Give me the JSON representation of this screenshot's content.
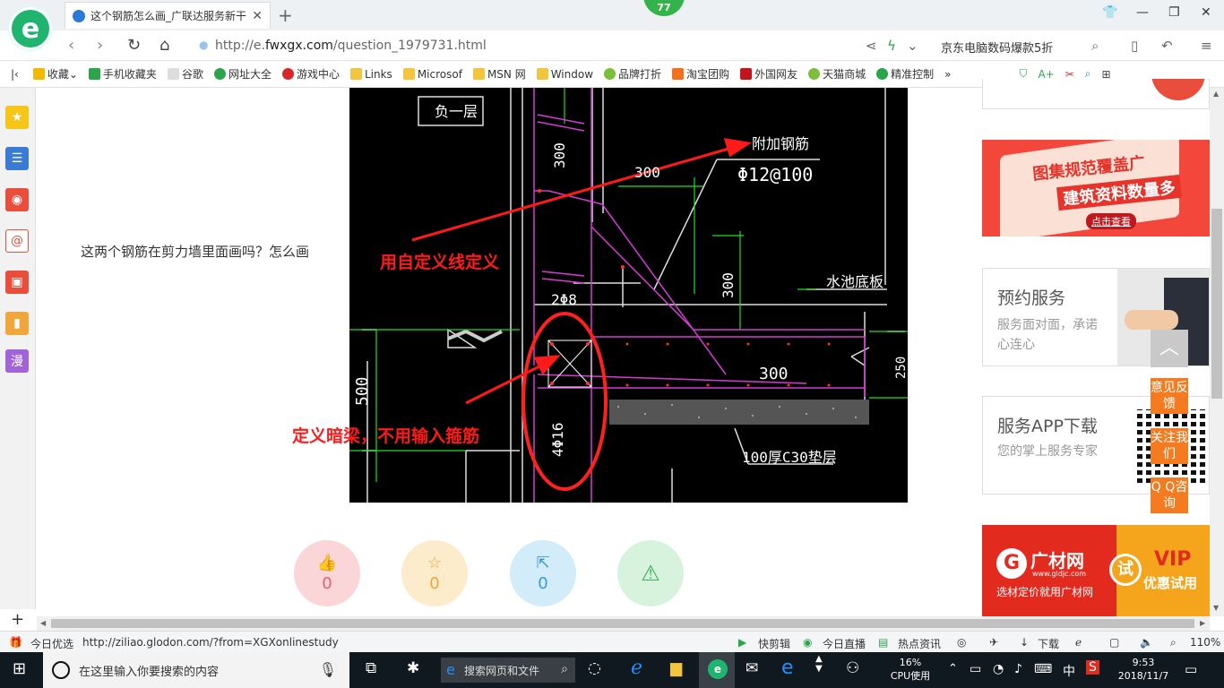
{
  "browser": {
    "tab_title": "这个钢筋怎么画_广联达服务新干",
    "badge": "77",
    "url_prefix": "http://e.",
    "url_domain": "fwxgx.com",
    "url_path": "/question_1979731.html",
    "right_search": "京东电脑数码爆款5折"
  },
  "bookmarks": [
    {
      "label": "收藏",
      "color": "#f5b800"
    },
    {
      "label": "手机收藏夹",
      "color": "#2aa54a"
    },
    {
      "label": "谷歌",
      "color": "#888888"
    },
    {
      "label": "网址大全",
      "color": "#2aa54a"
    },
    {
      "label": "游戏中心",
      "color": "#d9262b"
    },
    {
      "label": "Links",
      "color": "#f3c43e"
    },
    {
      "label": "Microsof",
      "color": "#f3c43e"
    },
    {
      "label": "MSN 网",
      "color": "#f3c43e"
    },
    {
      "label": "Window",
      "color": "#f3c43e"
    },
    {
      "label": "品牌打折",
      "color": "#7cbf3a"
    },
    {
      "label": "淘宝团购",
      "color": "#f46f1e"
    },
    {
      "label": "外国网友",
      "color": "#c3161c"
    },
    {
      "label": "天猫商城",
      "color": "#7cbf3a"
    },
    {
      "label": "精准控制",
      "color": "#2aa54a"
    }
  ],
  "question_text": "这两个钢筋在剪力墙里面画吗？怎么画",
  "cad": {
    "label_floor": "负一层",
    "label_rebar": "附加钢筋",
    "label_rebar_spec": "Φ12@100",
    "dim_300_a": "300",
    "dim_300_b": "300",
    "dim_300_c": "300",
    "dim_300_d": "300",
    "label_2phi8": "2Φ8",
    "label_pool": "水池底板",
    "dim_500": "500",
    "label_4phi16": "4Φ16",
    "label_cushion": "100厚C30垫层",
    "dim_250": "250",
    "annot_custom_line": "用自定义线定义",
    "annot_hidden_beam": "定义暗梁，不用输入箍筋"
  },
  "actions": [
    {
      "icon": "thumb-up-icon",
      "glyph": "👍",
      "count": "0",
      "bg": "#fbd6d9",
      "color": "#e4606d"
    },
    {
      "icon": "star-icon",
      "glyph": "☆",
      "count": "0",
      "bg": "#fdeccb",
      "color": "#f0a63a"
    },
    {
      "icon": "share-icon",
      "glyph": "⇱",
      "count": "0",
      "bg": "#d2ecfa",
      "color": "#3a9ad6"
    },
    {
      "icon": "report-icon",
      "glyph": "⚠",
      "count": "",
      "bg": "#d7f3de",
      "color": "#3bb15a"
    }
  ],
  "right": {
    "promo1_line1": "图集规范覆盖广",
    "promo1_line2": "建筑资料数量多",
    "promo1_btn": "点击查看",
    "card1_title": "预约服务",
    "card1_sub": "服务面对面，承诺心连心",
    "card2_title": "服务APP下载",
    "card2_sub": "您的掌上服务专家",
    "promo2_brand": "广材网",
    "promo2_url": "www.gldjc.com",
    "promo2_tag": "选材定价就用广材网",
    "promo2_try": "试",
    "promo2_vip": "VIP",
    "promo2_vip_sub": "优惠试用",
    "float_feedback": "意见反馈",
    "float_follow": "关注我们",
    "float_qq": "Q Q咨询"
  },
  "status": {
    "today": "今日优选",
    "url": "http://ziliao.glodon.com/?from=XGXonlinestudy",
    "clip": "快剪辑",
    "live": "今日直播",
    "news": "热点资讯",
    "download": "下载",
    "zoom": "110%"
  },
  "taskbar": {
    "search_placeholder": "在这里输入你要搜索的内容",
    "web_search": "搜索网页和文件",
    "cpu_pct": "16%",
    "cpu_label": "CPU使用",
    "ime": "中",
    "time": "9:53",
    "date": "2018/11/7"
  }
}
